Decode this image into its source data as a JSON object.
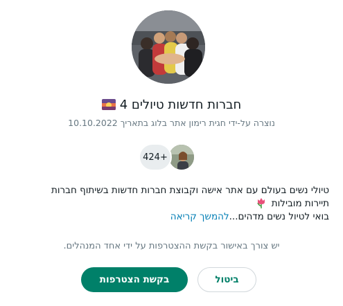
{
  "group": {
    "name": "חברות חדשות טיולים 4",
    "title_emoji": "sunset-emoji",
    "created_by": "נוצרה על-ידי חגית רימון אתר בלוג בתאריך 10.10.2022",
    "member_count": "424+"
  },
  "description": {
    "line1": "טיולי נשים בעולם עם אתר אישה וקבוצת חברות חדשות בשיתוף חברות",
    "line2": "תיירות מובילות",
    "line2_emoji": "tulip-emoji",
    "line3": "בואי לטיול נשים מדהים...",
    "read_more": "להמשך קריאה"
  },
  "approval_notice": "יש צורך באישור בקשת ההצטרפות על ידי אחד המנהלים.",
  "buttons": {
    "join": "בקשת הצטרפות",
    "cancel": "ביטול"
  },
  "colors": {
    "primary": "#008069",
    "link": "#027eb5",
    "muted_text": "#667781"
  }
}
